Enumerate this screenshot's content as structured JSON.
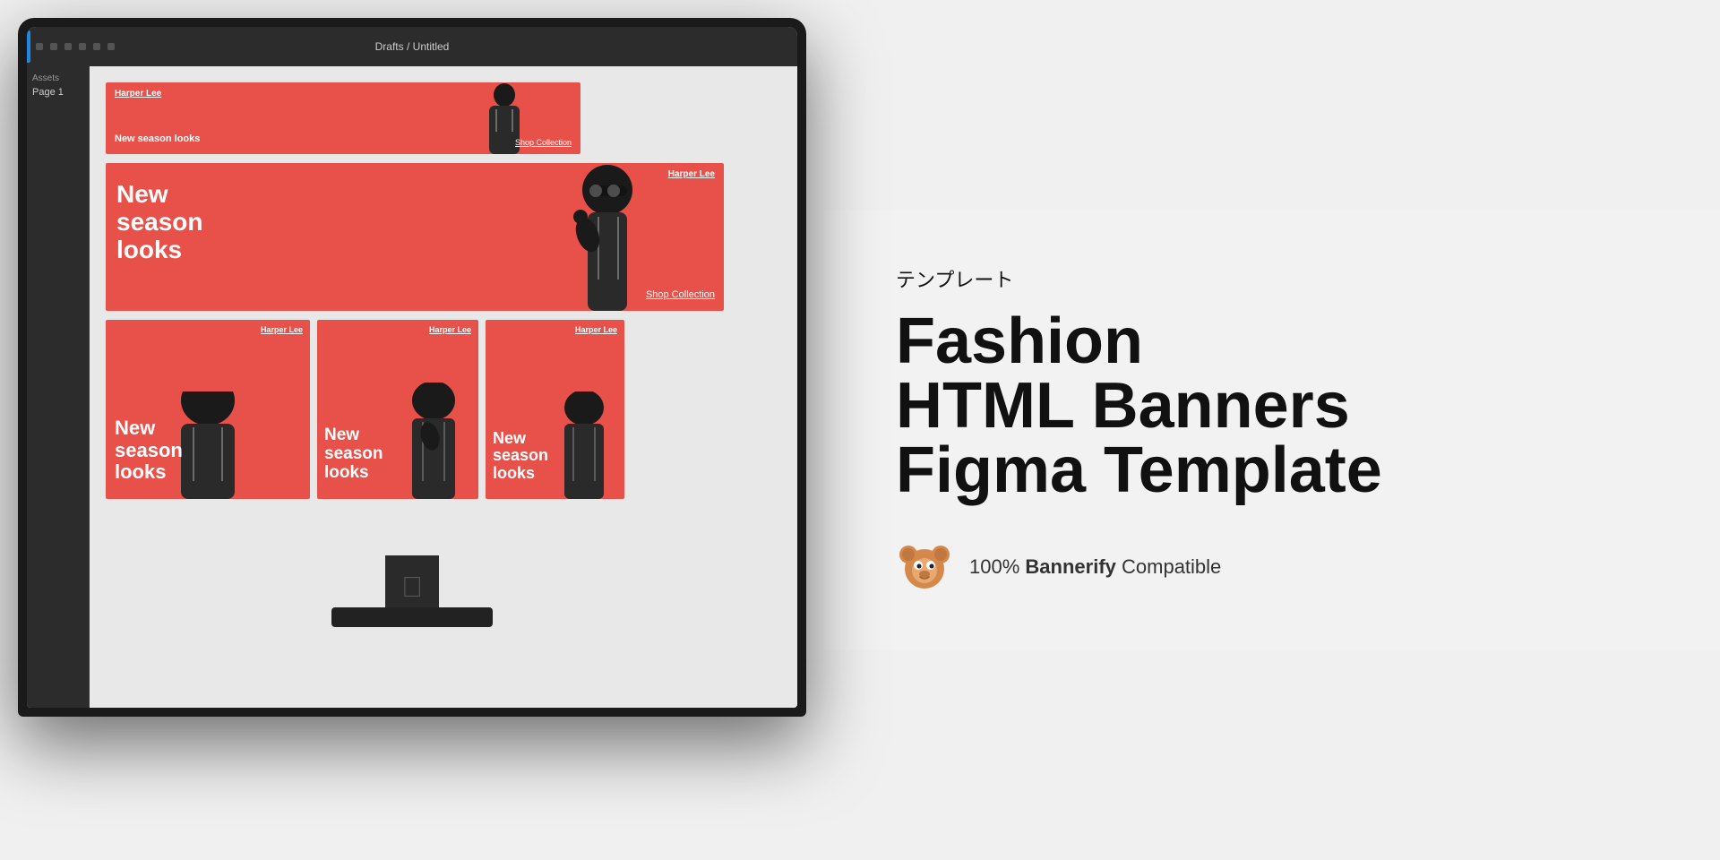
{
  "monitor": {
    "figma_bar": {
      "breadcrumb": "Drafts / Untitled"
    },
    "sidebar": {
      "assets_label": "Assets",
      "page_label": "Page 1"
    },
    "banners": {
      "brand": "Harper Lee",
      "headline": "New season looks",
      "shop_cta": "Shop Collection",
      "bg_color": "#e8514a"
    }
  },
  "right_panel": {
    "template_label": "テンプレート",
    "title_line1": "Fashion",
    "title_line2": "HTML Banners",
    "title_line3": "Figma Template",
    "compat_prefix": "100%",
    "compat_brand": "Bannerify",
    "compat_suffix": "Compatible",
    "bear_emoji": "🐻"
  }
}
